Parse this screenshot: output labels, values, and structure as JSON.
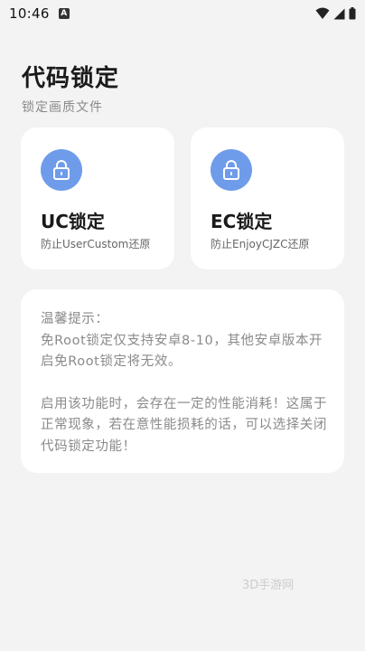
{
  "status_bar": {
    "time": "10:46",
    "notification_icon": "notification-a-icon",
    "right_icons": [
      "wifi-icon",
      "signal-icon",
      "battery-icon"
    ]
  },
  "header": {
    "title": "代码锁定",
    "subtitle": "锁定画质文件"
  },
  "cards": [
    {
      "icon": "lock-icon",
      "title": "UC锁定",
      "description": "防止UserCustom还原"
    },
    {
      "icon": "lock-icon",
      "title": "EC锁定",
      "description": "防止EnjoyCJZC还原"
    }
  ],
  "tips": {
    "heading": "温馨提示：",
    "paragraph1": "免Root锁定仅支持安卓8-10，其他安卓版本开启免Root锁定将无效。",
    "paragraph2": "启用该功能时，会存在一定的性能消耗！这属于正常现象，若在意性能损耗的话，可以选择关闭代码锁定功能！"
  },
  "watermark": "3D手游网",
  "colors": {
    "background": "#f3f3f4",
    "card": "#ffffff",
    "accent": "#6f9cea",
    "muted_text": "#8a8a8a"
  }
}
